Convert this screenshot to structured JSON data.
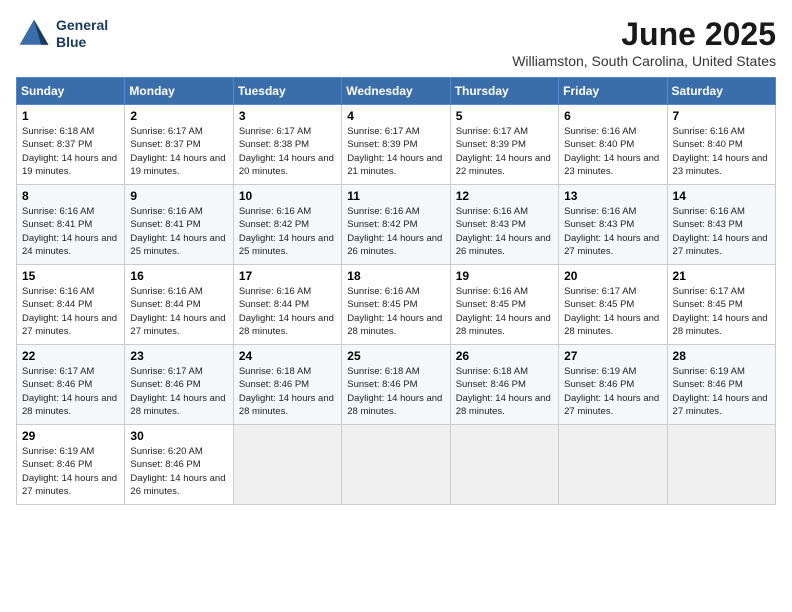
{
  "logo": {
    "line1": "General",
    "line2": "Blue"
  },
  "title": "June 2025",
  "subtitle": "Williamston, South Carolina, United States",
  "weekdays": [
    "Sunday",
    "Monday",
    "Tuesday",
    "Wednesday",
    "Thursday",
    "Friday",
    "Saturday"
  ],
  "weeks": [
    [
      {
        "day": "1",
        "sunrise": "Sunrise: 6:18 AM",
        "sunset": "Sunset: 8:37 PM",
        "daylight": "Daylight: 14 hours and 19 minutes."
      },
      {
        "day": "2",
        "sunrise": "Sunrise: 6:17 AM",
        "sunset": "Sunset: 8:37 PM",
        "daylight": "Daylight: 14 hours and 19 minutes."
      },
      {
        "day": "3",
        "sunrise": "Sunrise: 6:17 AM",
        "sunset": "Sunset: 8:38 PM",
        "daylight": "Daylight: 14 hours and 20 minutes."
      },
      {
        "day": "4",
        "sunrise": "Sunrise: 6:17 AM",
        "sunset": "Sunset: 8:39 PM",
        "daylight": "Daylight: 14 hours and 21 minutes."
      },
      {
        "day": "5",
        "sunrise": "Sunrise: 6:17 AM",
        "sunset": "Sunset: 8:39 PM",
        "daylight": "Daylight: 14 hours and 22 minutes."
      },
      {
        "day": "6",
        "sunrise": "Sunrise: 6:16 AM",
        "sunset": "Sunset: 8:40 PM",
        "daylight": "Daylight: 14 hours and 23 minutes."
      },
      {
        "day": "7",
        "sunrise": "Sunrise: 6:16 AM",
        "sunset": "Sunset: 8:40 PM",
        "daylight": "Daylight: 14 hours and 23 minutes."
      }
    ],
    [
      {
        "day": "8",
        "sunrise": "Sunrise: 6:16 AM",
        "sunset": "Sunset: 8:41 PM",
        "daylight": "Daylight: 14 hours and 24 minutes."
      },
      {
        "day": "9",
        "sunrise": "Sunrise: 6:16 AM",
        "sunset": "Sunset: 8:41 PM",
        "daylight": "Daylight: 14 hours and 25 minutes."
      },
      {
        "day": "10",
        "sunrise": "Sunrise: 6:16 AM",
        "sunset": "Sunset: 8:42 PM",
        "daylight": "Daylight: 14 hours and 25 minutes."
      },
      {
        "day": "11",
        "sunrise": "Sunrise: 6:16 AM",
        "sunset": "Sunset: 8:42 PM",
        "daylight": "Daylight: 14 hours and 26 minutes."
      },
      {
        "day": "12",
        "sunrise": "Sunrise: 6:16 AM",
        "sunset": "Sunset: 8:43 PM",
        "daylight": "Daylight: 14 hours and 26 minutes."
      },
      {
        "day": "13",
        "sunrise": "Sunrise: 6:16 AM",
        "sunset": "Sunset: 8:43 PM",
        "daylight": "Daylight: 14 hours and 27 minutes."
      },
      {
        "day": "14",
        "sunrise": "Sunrise: 6:16 AM",
        "sunset": "Sunset: 8:43 PM",
        "daylight": "Daylight: 14 hours and 27 minutes."
      }
    ],
    [
      {
        "day": "15",
        "sunrise": "Sunrise: 6:16 AM",
        "sunset": "Sunset: 8:44 PM",
        "daylight": "Daylight: 14 hours and 27 minutes."
      },
      {
        "day": "16",
        "sunrise": "Sunrise: 6:16 AM",
        "sunset": "Sunset: 8:44 PM",
        "daylight": "Daylight: 14 hours and 27 minutes."
      },
      {
        "day": "17",
        "sunrise": "Sunrise: 6:16 AM",
        "sunset": "Sunset: 8:44 PM",
        "daylight": "Daylight: 14 hours and 28 minutes."
      },
      {
        "day": "18",
        "sunrise": "Sunrise: 6:16 AM",
        "sunset": "Sunset: 8:45 PM",
        "daylight": "Daylight: 14 hours and 28 minutes."
      },
      {
        "day": "19",
        "sunrise": "Sunrise: 6:16 AM",
        "sunset": "Sunset: 8:45 PM",
        "daylight": "Daylight: 14 hours and 28 minutes."
      },
      {
        "day": "20",
        "sunrise": "Sunrise: 6:17 AM",
        "sunset": "Sunset: 8:45 PM",
        "daylight": "Daylight: 14 hours and 28 minutes."
      },
      {
        "day": "21",
        "sunrise": "Sunrise: 6:17 AM",
        "sunset": "Sunset: 8:45 PM",
        "daylight": "Daylight: 14 hours and 28 minutes."
      }
    ],
    [
      {
        "day": "22",
        "sunrise": "Sunrise: 6:17 AM",
        "sunset": "Sunset: 8:46 PM",
        "daylight": "Daylight: 14 hours and 28 minutes."
      },
      {
        "day": "23",
        "sunrise": "Sunrise: 6:17 AM",
        "sunset": "Sunset: 8:46 PM",
        "daylight": "Daylight: 14 hours and 28 minutes."
      },
      {
        "day": "24",
        "sunrise": "Sunrise: 6:18 AM",
        "sunset": "Sunset: 8:46 PM",
        "daylight": "Daylight: 14 hours and 28 minutes."
      },
      {
        "day": "25",
        "sunrise": "Sunrise: 6:18 AM",
        "sunset": "Sunset: 8:46 PM",
        "daylight": "Daylight: 14 hours and 28 minutes."
      },
      {
        "day": "26",
        "sunrise": "Sunrise: 6:18 AM",
        "sunset": "Sunset: 8:46 PM",
        "daylight": "Daylight: 14 hours and 28 minutes."
      },
      {
        "day": "27",
        "sunrise": "Sunrise: 6:19 AM",
        "sunset": "Sunset: 8:46 PM",
        "daylight": "Daylight: 14 hours and 27 minutes."
      },
      {
        "day": "28",
        "sunrise": "Sunrise: 6:19 AM",
        "sunset": "Sunset: 8:46 PM",
        "daylight": "Daylight: 14 hours and 27 minutes."
      }
    ],
    [
      {
        "day": "29",
        "sunrise": "Sunrise: 6:19 AM",
        "sunset": "Sunset: 8:46 PM",
        "daylight": "Daylight: 14 hours and 27 minutes."
      },
      {
        "day": "30",
        "sunrise": "Sunrise: 6:20 AM",
        "sunset": "Sunset: 8:46 PM",
        "daylight": "Daylight: 14 hours and 26 minutes."
      },
      null,
      null,
      null,
      null,
      null
    ]
  ]
}
